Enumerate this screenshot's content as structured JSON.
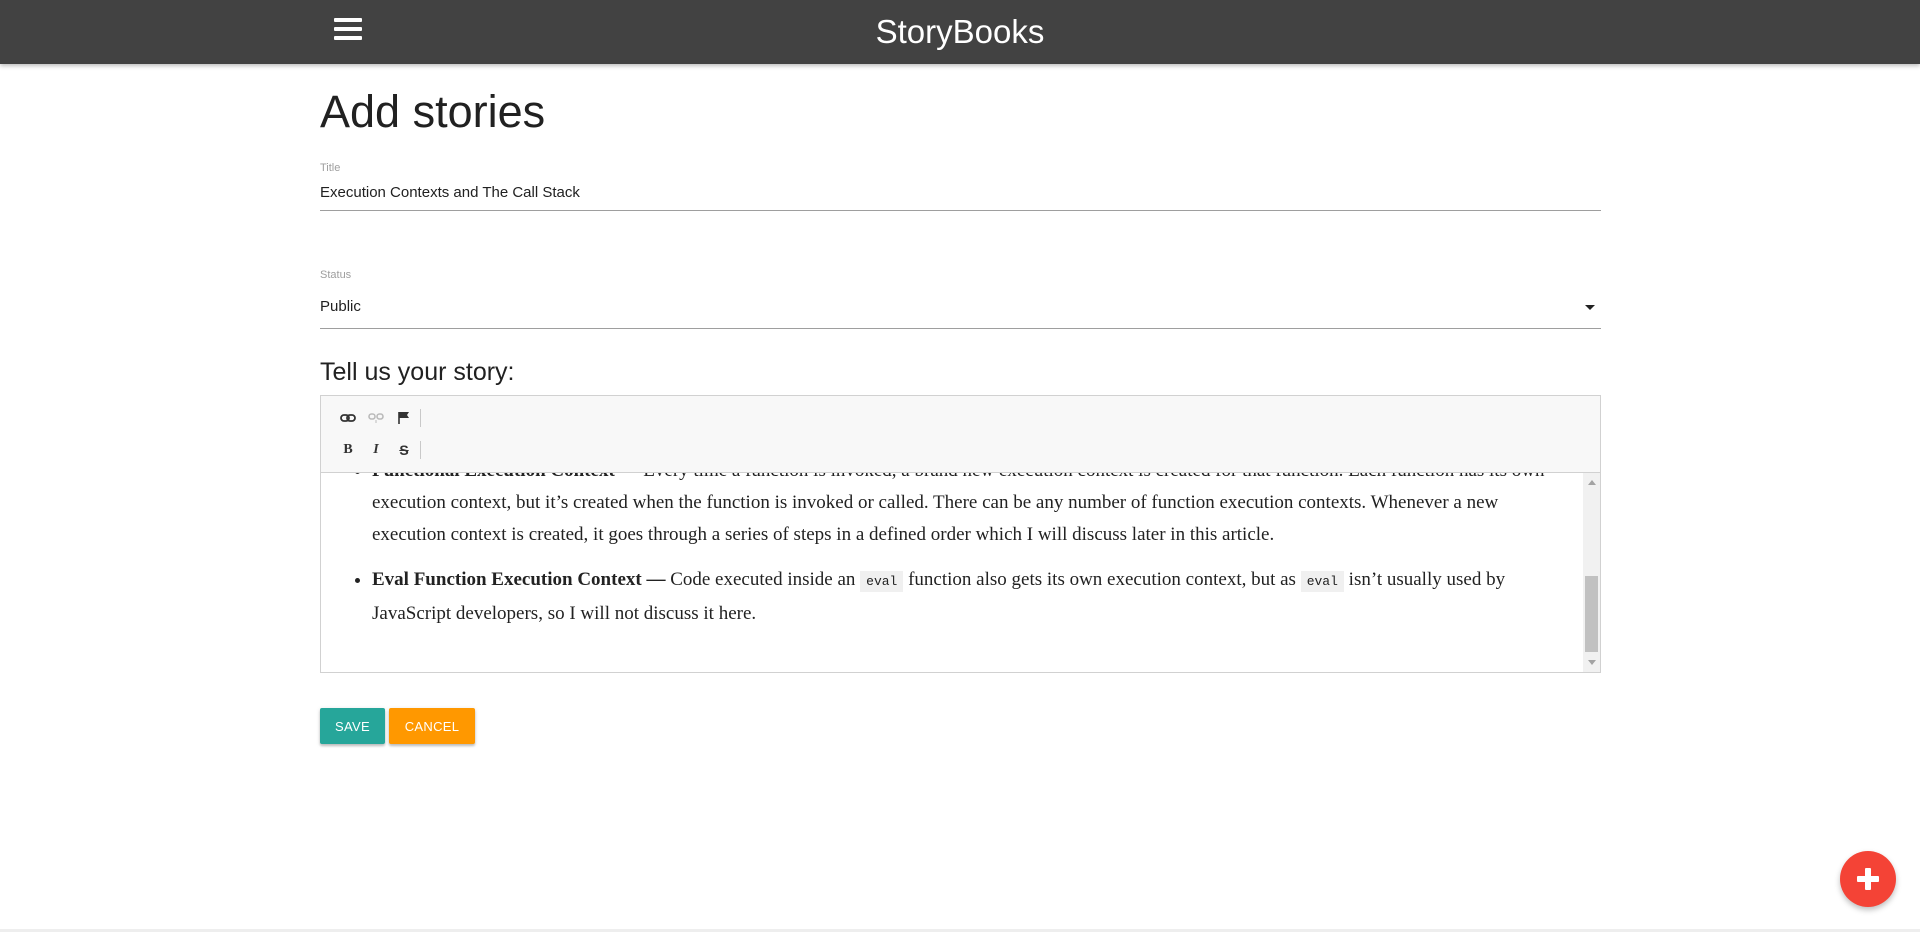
{
  "navbar": {
    "brand": "StoryBooks",
    "menu_icon": "hamburger-icon",
    "background": "#424242"
  },
  "page": {
    "title": "Add stories"
  },
  "form": {
    "title_label": "Title",
    "title_value": "Execution Contexts and The Call Stack",
    "status_label": "Status",
    "status_value": "Public",
    "story_label": "Tell us your story:"
  },
  "editor": {
    "toolbar_row1": [
      {
        "icon": "link-icon",
        "name": "link"
      },
      {
        "icon": "unlink-icon",
        "name": "unlink"
      },
      {
        "icon": "anchor-flag-icon",
        "name": "anchor"
      }
    ],
    "toolbar_row2": [
      {
        "label": "B",
        "name": "bold"
      },
      {
        "label": "I",
        "name": "italic"
      },
      {
        "label": "S",
        "name": "strikethrough"
      }
    ],
    "item1_bold": "Functional Execution Context",
    "item1_text": " — Every time a function is invoked, a brand new execution context is created for that function. Each function has its own execution context, but it’s created when the function is invoked or called. There can be any number of function execution contexts. Whenever a new execution context is created, it goes through a series of steps in a defined order which I will discuss later in this article.",
    "item2_bold": "Eval Function Execution Context —",
    "item2_text_a": " Code executed inside an ",
    "item2_code_a": "eval",
    "item2_text_b": " function also gets its own execution context, but as ",
    "item2_code_b": "eval",
    "item2_text_c": " isn’t usually used by JavaScript developers, so I will not discuss it here."
  },
  "buttons": {
    "save": "Save",
    "cancel": "Cancel",
    "save_color": "#26a69a",
    "cancel_color": "#ff9800"
  },
  "fab": {
    "icon": "plus-icon",
    "color": "#f44336"
  }
}
